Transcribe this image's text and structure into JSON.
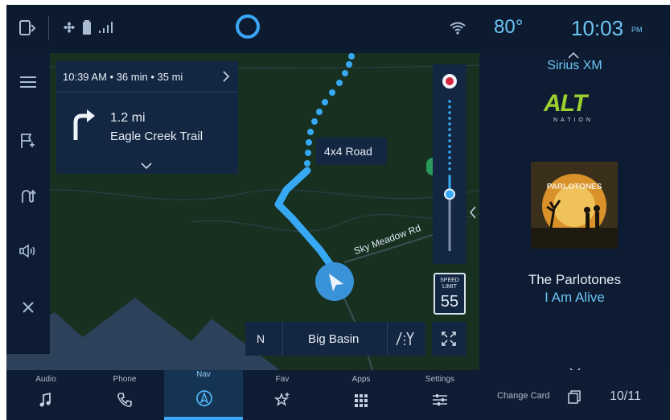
{
  "status_bar": {
    "temperature": "80°",
    "time": "10:03",
    "ampm": "PM"
  },
  "navigation": {
    "eta_summary": "10:39 AM • 36 min • 35 mi",
    "next_turn_distance": "1.2 mi",
    "next_turn_street": "Eagle Creek Trail",
    "route_label": "4x4 Road",
    "map_street": "Sky Meadow Rd",
    "speed_limit_label": "SPEED LIMIT",
    "speed_limit_value": "55",
    "heading": "N",
    "destination": "Big Basin",
    "zoom_level_fraction": 0.38
  },
  "media": {
    "source": "Sirius XM",
    "station_logo_main": "ALT",
    "station_logo_sub": "NATION",
    "album_art_title": "PARLOTONES",
    "artist": "The Parlotones",
    "track": "I Am Alive"
  },
  "bottom_nav": {
    "tabs": [
      "Audio",
      "Phone",
      "Nav",
      "Fav",
      "Apps",
      "Settings"
    ],
    "active": "Nav",
    "change_card": "Change Card",
    "card_counter": "10/11"
  },
  "colors": {
    "accent": "#3a9be0",
    "route": "#37a9f4",
    "map_land": "#17301f",
    "panel": "#142742",
    "media_text": "#6cc4f3"
  }
}
